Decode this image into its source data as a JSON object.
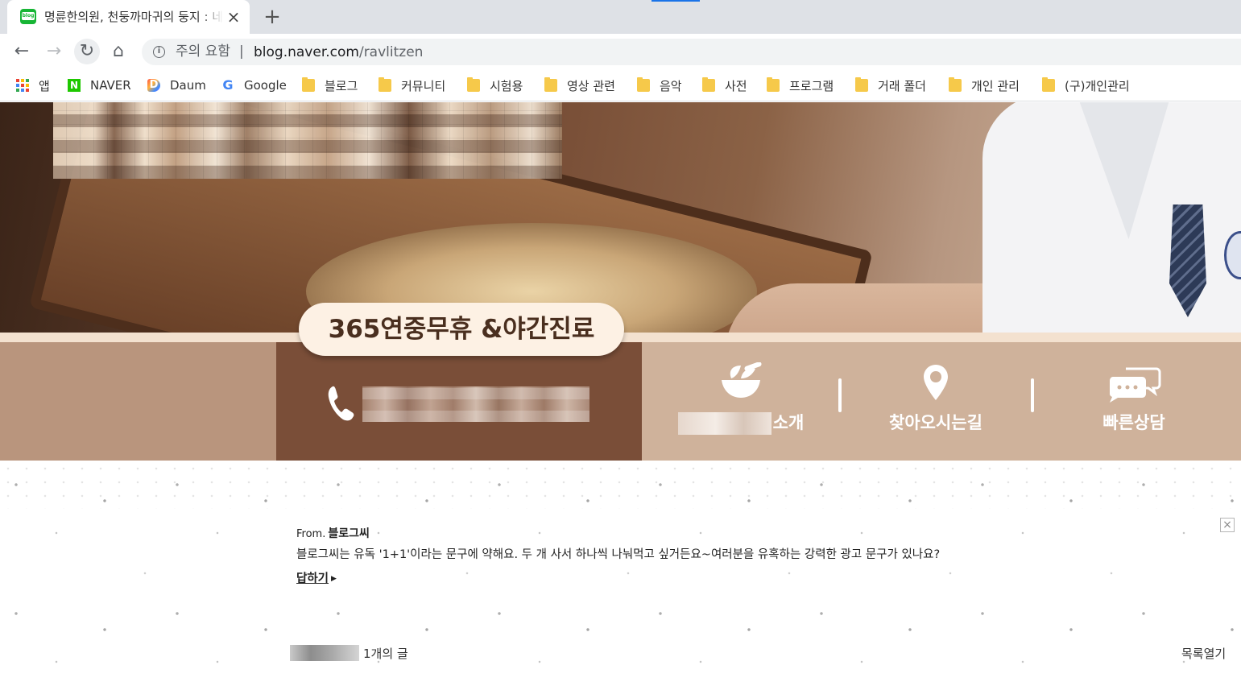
{
  "browser": {
    "tab_title": "명륜한의원, 천둥까마귀의 둥지 : 네이버 블로그",
    "tab_close": "×",
    "new_tab": "+",
    "security_label": "주의 요함",
    "url_separator": "|",
    "url_host": "blog.naver.com",
    "url_path": "/ravlitzen"
  },
  "bookmarks": [
    {
      "label": "앱",
      "icon": "apps-icon"
    },
    {
      "label": "NAVER",
      "icon": "naver-icon"
    },
    {
      "label": "Daum",
      "icon": "daum-icon"
    },
    {
      "label": "Google",
      "icon": "google-icon"
    },
    {
      "label": "블로그",
      "icon": "folder-icon"
    },
    {
      "label": "커뮤니티",
      "icon": "folder-icon"
    },
    {
      "label": "시험용",
      "icon": "folder-icon"
    },
    {
      "label": "영상 관련",
      "icon": "folder-icon"
    },
    {
      "label": "음악",
      "icon": "folder-icon"
    },
    {
      "label": "사전",
      "icon": "folder-icon"
    },
    {
      "label": "프로그램",
      "icon": "folder-icon"
    },
    {
      "label": "거래 폴더",
      "icon": "folder-icon"
    },
    {
      "label": "개인 관리",
      "icon": "folder-icon"
    },
    {
      "label": "(구)개인관리",
      "icon": "folder-icon"
    }
  ],
  "header": {
    "pill_text": "365연중무휴 &야간진료",
    "menu": {
      "intro_label": "소개",
      "directions_label": "찾아오시는길",
      "consult_label": "빠른상담"
    }
  },
  "content": {
    "from_prefix": "From.",
    "from_name": "블로그씨",
    "question": "블로그씨는 유독 '1+1'이라는 문구에 약해요. 두 개 사서 하나씩 나눠먹고 싶거든요~여러분을 유혹하는 강력한 광고 문구가 있나요?",
    "reply_label": "답하기",
    "close_symbol": "×",
    "post_count": "1개의 글",
    "list_open": "목록열기"
  },
  "colors": {
    "naver_green": "#1ec800",
    "header_brown": "#7a4e38",
    "header_tan": "#c7ab95",
    "pill_bg": "#fdf1e4"
  }
}
